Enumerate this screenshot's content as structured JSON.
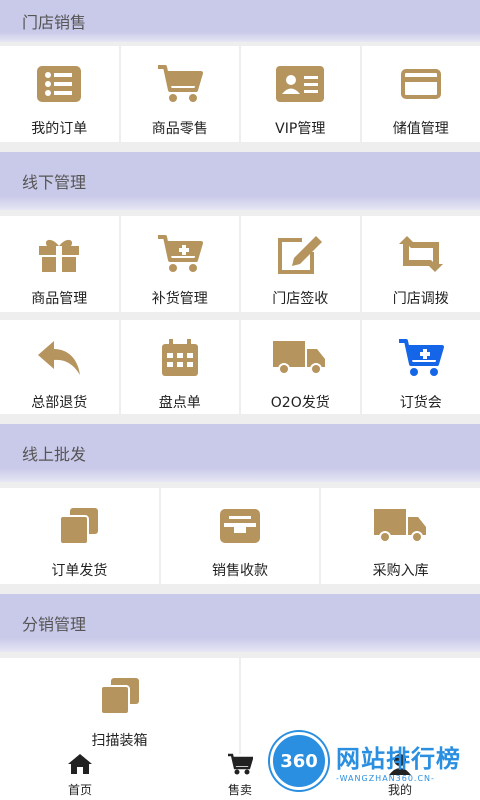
{
  "sections": {
    "store_sales": "门店销售",
    "offline": "线下管理",
    "online": "线上批发",
    "distribution": "分销管理"
  },
  "items": {
    "my_orders": {
      "label": "我的订单",
      "icon": "list-icon"
    },
    "retail": {
      "label": "商品零售",
      "icon": "cart-icon"
    },
    "vip": {
      "label": "VIP管理",
      "icon": "id-card-icon"
    },
    "stored_value": {
      "label": "储值管理",
      "icon": "credit-card-icon"
    },
    "goods_mgmt": {
      "label": "商品管理",
      "icon": "gift-icon"
    },
    "restock": {
      "label": "补货管理",
      "icon": "cart-plus-icon"
    },
    "store_receive": {
      "label": "门店签收",
      "icon": "edit-icon"
    },
    "store_transfer": {
      "label": "门店调拨",
      "icon": "exchange-icon"
    },
    "hq_return": {
      "label": "总部退货",
      "icon": "reply-icon"
    },
    "inventory": {
      "label": "盘点单",
      "icon": "calendar-icon"
    },
    "o2o": {
      "label": "O2O发货",
      "icon": "truck-icon"
    },
    "order_meeting": {
      "label": "订货会",
      "icon": "cart-plus-icon"
    },
    "order_ship": {
      "label": "订单发货",
      "icon": "copy-icon"
    },
    "sales_collect": {
      "label": "销售收款",
      "icon": "inbox-icon"
    },
    "purchase_in": {
      "label": "采购入库",
      "icon": "truck-icon"
    },
    "scan_box": {
      "label": "扫描装箱",
      "icon": "copy-icon"
    }
  },
  "tabs": {
    "home": "首页",
    "sell": "售卖",
    "mine": "我的"
  },
  "watermark": {
    "badge": "360",
    "main": "网站排行榜",
    "sub": "-WANGZHAN360.CN-"
  },
  "colors": {
    "icon": "#b5945e",
    "icon_accent": "#1565e8",
    "header_bg": "#c9c9e9"
  }
}
